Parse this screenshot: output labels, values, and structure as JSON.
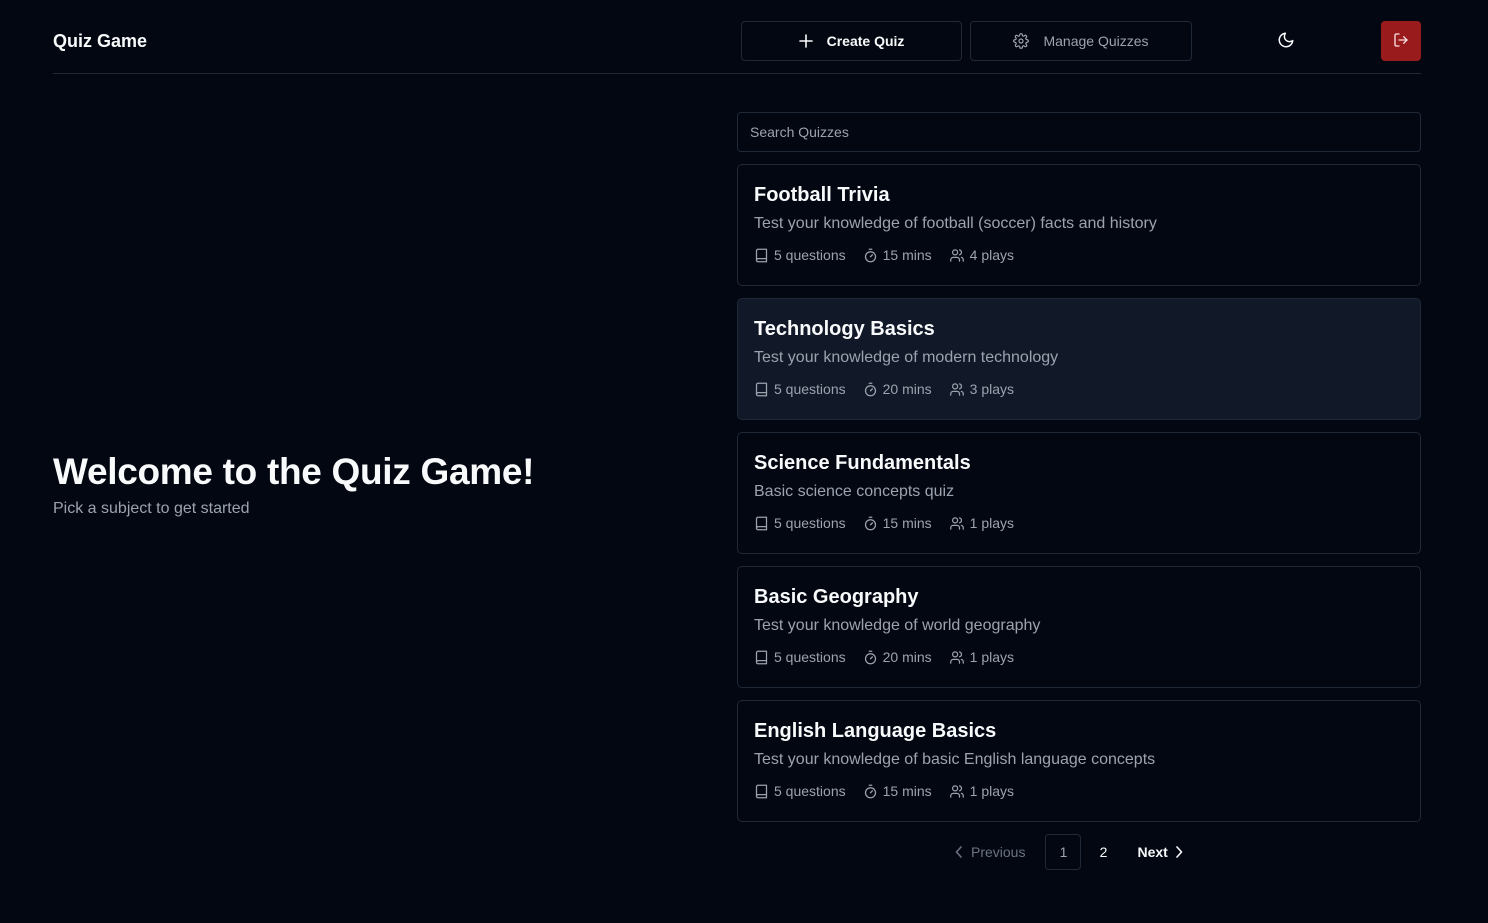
{
  "header": {
    "title": "Quiz Game",
    "create_label": "Create Quiz",
    "manage_label": "Manage Quizzes",
    "theme_icon": "moon-icon",
    "logout_icon": "logout-icon",
    "logout_color": "#991b1b"
  },
  "welcome": {
    "title": "Welcome to the Quiz Game!",
    "subtitle": "Pick a subject to get started"
  },
  "search": {
    "placeholder": "Search Quizzes",
    "value": ""
  },
  "quizzes": [
    {
      "title": "Football Trivia",
      "description": "Test your knowledge of football (soccer) facts and history",
      "questions": "5 questions",
      "duration": "15 mins",
      "plays": "4 plays"
    },
    {
      "title": "Technology Basics",
      "description": "Test your knowledge of modern technology",
      "questions": "5 questions",
      "duration": "20 mins",
      "plays": "3 plays"
    },
    {
      "title": "Science Fundamentals",
      "description": "Basic science concepts quiz",
      "questions": "5 questions",
      "duration": "15 mins",
      "plays": "1 plays"
    },
    {
      "title": "Basic Geography",
      "description": "Test your knowledge of world geography",
      "questions": "5 questions",
      "duration": "20 mins",
      "plays": "1 plays"
    },
    {
      "title": "English Language Basics",
      "description": "Test your knowledge of basic English language concepts",
      "questions": "5 questions",
      "duration": "15 mins",
      "plays": "1 plays"
    }
  ],
  "pagination": {
    "previous_label": "Previous",
    "pages": [
      "1",
      "2"
    ],
    "current_page": "1",
    "next_label": "Next"
  }
}
